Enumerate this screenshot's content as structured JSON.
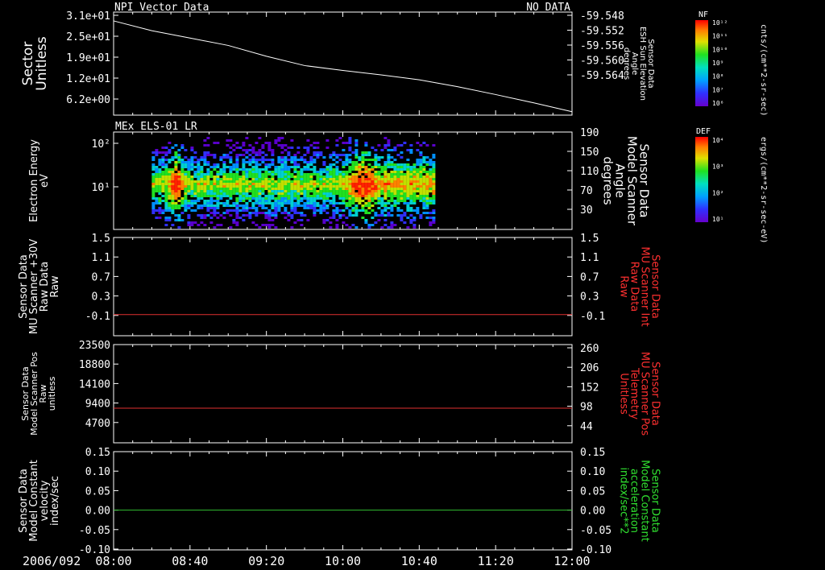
{
  "header": {
    "panel_title": "NPI Vector Data",
    "status": "NO DATA"
  },
  "time_axis": {
    "date_label": "2006/092",
    "ticks": [
      "08:00",
      "08:40",
      "09:20",
      "10:00",
      "10:40",
      "11:20",
      "12:00"
    ],
    "tick_minutes": [
      0,
      40,
      80,
      120,
      160,
      200,
      240
    ]
  },
  "colorbars": [
    {
      "label": "NF",
      "unit": "cnts/(cm**2-sr-sec)",
      "tick_labels": [
        "10¹²",
        "10¹¹",
        "10¹⁰",
        "10⁹",
        "10⁸",
        "10⁷",
        "10⁶"
      ]
    },
    {
      "label": "DEF",
      "unit": "ergs/(cm**2-sr-sec-eV)",
      "tick_labels": [
        "10⁴",
        "10³",
        "10²",
        "10¹"
      ]
    }
  ],
  "colors": {
    "line_white": "#ffffff",
    "line_red": "#e03030",
    "line_green": "#30c030",
    "label_red": "#ff3030",
    "label_green": "#30e030"
  },
  "chart_data": [
    {
      "type": "line",
      "title": "NPI Vector Data",
      "ylabel_left": [
        "Sector",
        "Unitless"
      ],
      "ylabel_right": [
        "Sensor Data",
        "ESH Sun Elevation",
        "Angle",
        "degrees"
      ],
      "yticks_left": [
        "3.1e+01",
        "2.5e+01",
        "1.9e+01",
        "1.2e+01",
        "6.2e+00"
      ],
      "yticks_right": [
        "-59.548",
        "-59.552",
        "-59.556",
        "-59.560",
        "-59.564"
      ],
      "ylim_right": [
        -59.567,
        -59.547
      ],
      "series": [
        {
          "color": "white",
          "x_minutes": [
            0,
            20,
            40,
            60,
            80,
            100,
            120,
            140,
            160,
            180,
            200,
            220,
            240
          ],
          "values": [
            -59.5483,
            -59.5503,
            -59.5518,
            -59.5533,
            -59.5555,
            -59.5574,
            -59.5584,
            -59.5593,
            -59.5603,
            -59.5617,
            -59.5633,
            -59.565,
            -59.5668
          ]
        }
      ]
    },
    {
      "type": "heatmap",
      "title": "MEx ELS-01 LR",
      "ylabel_left": [
        "Electron Energy",
        "eV"
      ],
      "ylabel_right": [
        "Sensor Data",
        "Model Scanner",
        "Angle",
        "degrees"
      ],
      "yticks_left": [
        "10²",
        "10¹"
      ],
      "yticks_right": [
        "190",
        "150",
        "110",
        "70",
        "30"
      ],
      "data_start_minute": 20,
      "data_end_minute": 167
    },
    {
      "type": "line",
      "ylabel_left": [
        "Sensor Data",
        "MU Scanner +30V",
        "Raw Data",
        "Raw"
      ],
      "ylabel_right": [
        "Sensor Data",
        "MU Scanner Int",
        "Raw Data",
        "Raw"
      ],
      "yticks_left": [
        "1.5",
        "1.1",
        "0.7",
        "0.3",
        "-0.1"
      ],
      "yticks_right": [
        "1.5",
        "1.1",
        "0.7",
        "0.3",
        "-0.1"
      ],
      "ylim": [
        -0.5,
        1.5
      ],
      "series": [
        {
          "color": "red",
          "x_minutes": [
            0,
            240
          ],
          "values": [
            -0.1,
            -0.1
          ]
        }
      ]
    },
    {
      "type": "line",
      "ylabel_left": [
        "Sensor Data",
        "Model Scanner Pos",
        "Raw",
        "unitless"
      ],
      "ylabel_right": [
        "Sensor Data",
        "MU Scanner Pos",
        "Telemetry",
        "Unitless"
      ],
      "yticks_left": [
        "23500",
        "18800",
        "14100",
        "9400",
        "4700"
      ],
      "yticks_right": [
        "260",
        "206",
        "152",
        "98",
        "44"
      ],
      "ylim_left": [
        0,
        23500
      ],
      "series": [
        {
          "color": "red",
          "x_minutes": [
            0,
            240
          ],
          "values": [
            8100,
            8100
          ]
        }
      ]
    },
    {
      "type": "line",
      "ylabel_left": [
        "Sensor Data",
        "Model Constant",
        "velocity",
        "index/sec"
      ],
      "ylabel_right": [
        "Sensor Data",
        "Model Constant",
        "acceleration",
        "index/sec**2"
      ],
      "yticks_left": [
        "0.15",
        "0.10",
        "0.05",
        "0.00",
        "-0.05",
        "-0.10"
      ],
      "yticks_right": [
        "0.15",
        "0.10",
        "0.05",
        "0.00",
        "-0.05",
        "-0.10"
      ],
      "ylim": [
        -0.1,
        0.15
      ],
      "series": [
        {
          "color": "green",
          "x_minutes": [
            0,
            240
          ],
          "values": [
            0.0,
            0.0
          ]
        }
      ]
    }
  ]
}
